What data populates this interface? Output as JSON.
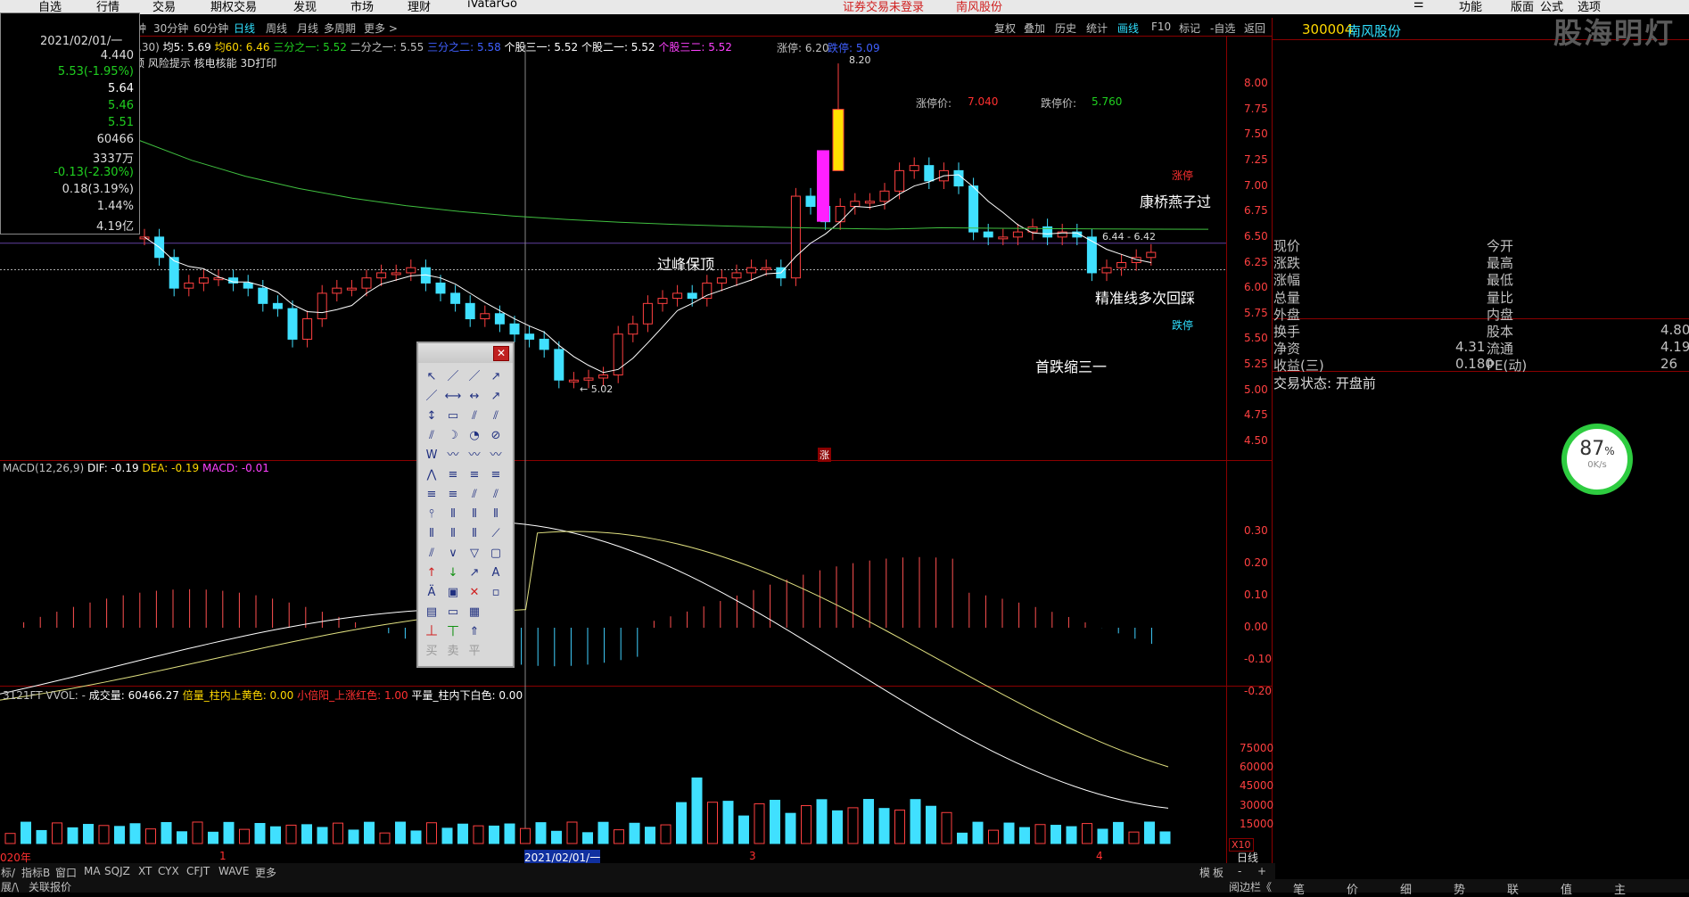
{
  "menu": {
    "items": [
      "自选",
      "行情",
      "交易",
      "期权交易",
      "发现",
      "市场",
      "理财",
      "iVatarGo"
    ],
    "right_items": [
      "功能",
      "版面",
      "公式",
      "选项"
    ],
    "status": "证券交易未登录",
    "title_stock": "南风股份"
  },
  "periods": {
    "items": [
      "钟",
      "30分钟",
      "60分钟",
      "日线",
      "周线",
      "月线",
      "多周期",
      "更多 >"
    ],
    "active": "日线"
  },
  "toolbar": {
    "items": [
      "复权",
      "叠加",
      "历史",
      "统计",
      "画线",
      "F10",
      "标记",
      "-自选",
      "返回"
    ],
    "active": "画线"
  },
  "stock": {
    "code": "300004",
    "name": "南风股份"
  },
  "watermark": "股海明灯",
  "ma_line": {
    "parts": [
      ",30)",
      "均5: 5.69",
      "均60: 6.46",
      "三分之一: 5.52",
      "二分之一: 5.55",
      "三分之二: 5.58",
      "个股三一: 5.52",
      "个股二一: 5.52",
      "个股三二: 5.52"
    ],
    "limit_up": "涨停: 6.20",
    "limit_down": "跌停: 5.09"
  },
  "subtitle": "预 风险提示 核电核能 3D打印",
  "infobox": {
    "date": "2021/02/01/一",
    "rows": [
      "4.440",
      "5.53(-1.95%)",
      "5.64",
      "5.46",
      "5.51",
      "60466",
      "3337万",
      "-0.13(-2.30%)",
      "0.18(3.19%)",
      "1.44%",
      "4.19亿"
    ]
  },
  "price_labels": {
    "limit_up_label": "涨停价:",
    "limit_up_value": "7.040",
    "limit_down_label": "跌停价:",
    "limit_down_value": "5.760",
    "peak": "8.20",
    "low": "← 5.02",
    "range": "6.44 - 6.42"
  },
  "annotations": {
    "guofeng": "过峰保顶",
    "kangqiao": "康桥燕子过",
    "jingzhun": "精准线多次回踩",
    "shoudie": "首跌缩三一",
    "zhangting": "涨停",
    "dieting": "跌停",
    "zhang_marker": "涨"
  },
  "price_axis": [
    "8.00",
    "7.75",
    "7.50",
    "7.25",
    "7.00",
    "6.75",
    "6.50",
    "6.25",
    "6.00",
    "5.75",
    "5.50",
    "5.25",
    "5.00",
    "4.75",
    "4.50"
  ],
  "macd": {
    "title": "MACD(12,26,9)",
    "dif": "DIF: -0.19",
    "dea": "DEA: -0.19",
    "macd": "MACD: -0.01",
    "axis": [
      "0.30",
      "0.20",
      "0.10",
      "0.00",
      "-0.10",
      "-0.20"
    ]
  },
  "vol": {
    "title": "3121FT VVOL: -",
    "items": [
      "成交量: 60466.27",
      "倍量_柱内上黄色: 0.00",
      "小倍阳_上涨红色: 1.00",
      "平量_柱内下白色: 0.00"
    ],
    "axis": [
      "75000",
      "60000",
      "45000",
      "30000",
      "15000"
    ],
    "unit": "X10"
  },
  "xaxis": {
    "year": "020年",
    "marks": [
      "1",
      "2021/02/01/一",
      "3",
      "4"
    ],
    "period": "日线"
  },
  "right_panel": {
    "rows": [
      {
        "l": "现价",
        "m": "今开",
        "r": ""
      },
      {
        "l": "涨跌",
        "m": "最高",
        "r": ""
      },
      {
        "l": "涨幅",
        "m": "最低",
        "r": ""
      },
      {
        "l": "总量",
        "m": "量比",
        "r": ""
      },
      {
        "l": "外盘",
        "m": "内盘",
        "r": ""
      },
      {
        "l": "换手",
        "m": "股本",
        "r": "4.80"
      },
      {
        "l": "净资",
        "v": "4.31",
        "m": "流通",
        "r": "4.19"
      },
      {
        "l": "收益(三)",
        "v": "0.180",
        "m": "PE(动)",
        "r": "26"
      }
    ],
    "status": "交易状态: 开盘前"
  },
  "gauge": {
    "pct": "87",
    "unit": "%",
    "speed": "0K/s"
  },
  "bottombar": {
    "items": [
      "标/",
      "指标B",
      "窗口",
      "MA",
      "SQJZ",
      "XT",
      "CYX",
      "CFJT",
      "WAVE",
      "更多"
    ],
    "right": [
      "模",
      "板",
      "-",
      "+"
    ]
  },
  "bottom2": {
    "items": [
      "展/\\",
      "关联报价"
    ],
    "right": "阅边栏《"
  },
  "right_tabs": [
    "笔",
    "价",
    "细",
    "势",
    "联",
    "值",
    "主"
  ],
  "palette": {
    "bottom_labels": [
      "买",
      "卖",
      "平"
    ]
  },
  "chart_data": {
    "type": "candlestick",
    "price_axis_range": [
      4.5,
      8.0
    ],
    "peak": 8.2,
    "low": 5.02,
    "candles_approx_close": [
      6.5,
      6.3,
      6.0,
      6.05,
      6.1,
      6.1,
      6.05,
      6.0,
      5.85,
      5.8,
      5.5,
      5.7,
      5.95,
      6.0,
      6.0,
      6.1,
      6.15,
      6.15,
      6.2,
      6.05,
      5.95,
      5.85,
      5.7,
      5.75,
      5.65,
      5.55,
      5.5,
      5.4,
      5.1,
      5.1,
      5.12,
      5.15,
      5.55,
      5.65,
      5.85,
      5.9,
      5.95,
      5.9,
      6.05,
      6.1,
      6.15,
      6.2,
      6.2,
      6.1,
      6.9,
      6.8,
      6.65,
      6.8,
      6.85,
      6.85,
      6.95,
      7.15,
      7.2,
      7.05,
      7.15,
      7.0,
      6.55,
      6.5,
      6.5,
      6.55,
      6.6,
      6.5,
      6.55,
      6.5,
      6.15,
      6.2,
      6.25,
      6.3,
      6.35
    ]
  }
}
